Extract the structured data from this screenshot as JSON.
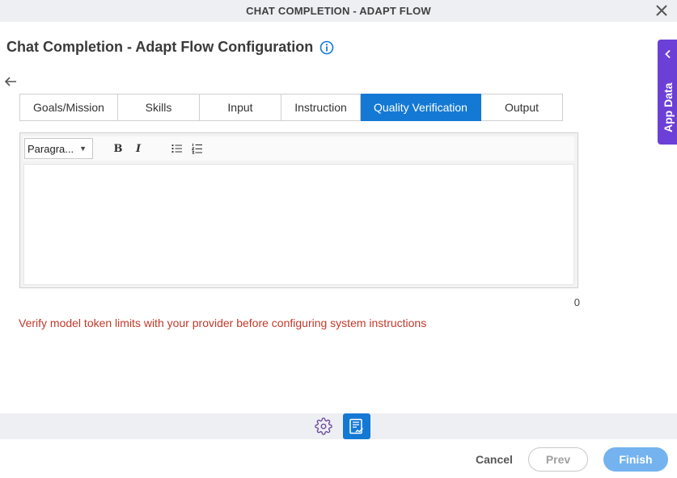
{
  "window": {
    "title": "CHAT COMPLETION - ADAPT FLOW"
  },
  "page": {
    "heading": "Chat Completion - Adapt Flow Configuration"
  },
  "tabs": [
    {
      "label": "Goals/Mission",
      "active": false
    },
    {
      "label": "Skills",
      "active": false
    },
    {
      "label": "Input",
      "active": false
    },
    {
      "label": "Instruction",
      "active": false
    },
    {
      "label": "Quality Verification",
      "active": true
    },
    {
      "label": "Output",
      "active": false
    }
  ],
  "editor": {
    "format_value": "Paragra...",
    "bold_label": "B",
    "italic_label": "I",
    "content": "",
    "char_count": "0"
  },
  "warning": "Verify model token limits with your provider before configuring system instructions",
  "side_panel": {
    "label": "App Data"
  },
  "footer": {
    "cancel": "Cancel",
    "prev": "Prev",
    "finish": "Finish"
  },
  "icons": {
    "close": "close-icon",
    "info": "info-icon",
    "back": "arrow-left-icon",
    "gear": "gear-icon",
    "document": "document-icon",
    "side_chevron": "chevron-left-icon"
  },
  "colors": {
    "accent": "#1479d5",
    "side_panel": "#6c3fd6",
    "warning": "#c0392b",
    "finish_button": "#74b3ef"
  }
}
